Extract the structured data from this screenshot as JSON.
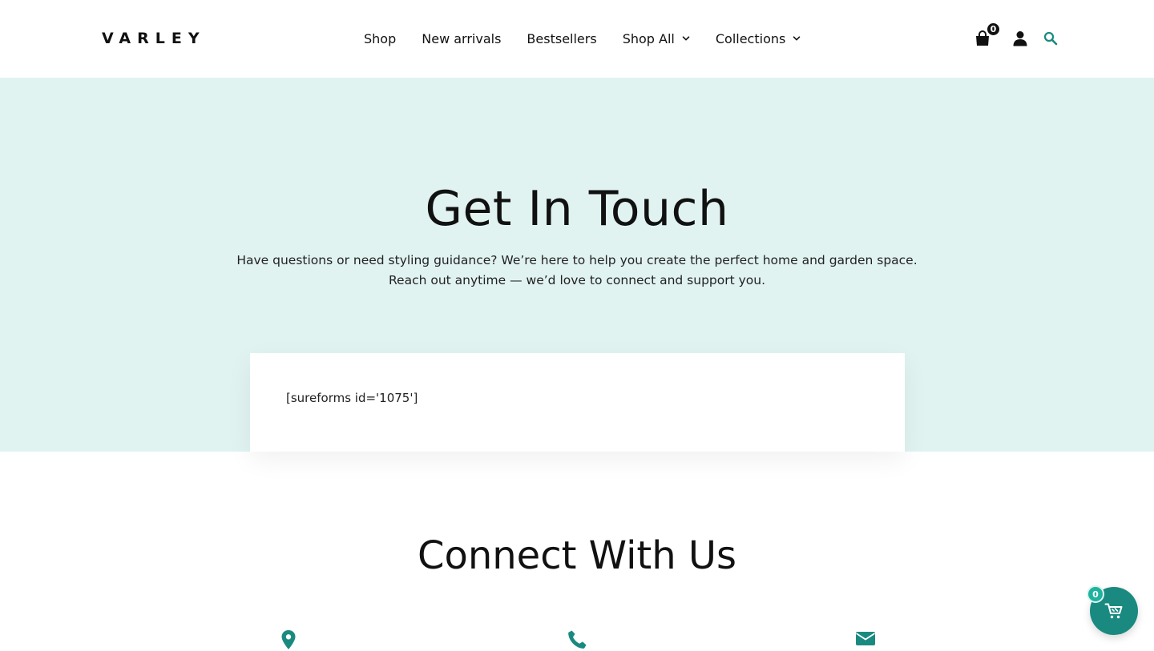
{
  "header": {
    "logo": "VARLEY",
    "nav": [
      {
        "label": "Shop",
        "has_dropdown": false
      },
      {
        "label": "New arrivals",
        "has_dropdown": false
      },
      {
        "label": "Bestsellers",
        "has_dropdown": false
      },
      {
        "label": "Shop All",
        "has_dropdown": true
      },
      {
        "label": "Collections",
        "has_dropdown": true
      }
    ],
    "cart_count": "0",
    "icons": [
      "shopping-bag-icon",
      "user-icon",
      "search-icon"
    ]
  },
  "hero": {
    "title": "Get In Touch",
    "text_line1": "Have questions or need styling guidance? We’re here to help you create the perfect home and garden space.",
    "text_line2": "Reach out anytime — we’d love to connect and support you.",
    "background": "#e0f3f1"
  },
  "form": {
    "shortcode": "[sureforms id='1075']"
  },
  "connect": {
    "title": "Connect With Us",
    "icons": [
      "map-pin-icon",
      "phone-icon",
      "envelope-icon"
    ]
  },
  "floating_cart": {
    "count": "0",
    "color": "#1a8a80"
  },
  "colors": {
    "accent": "#1a8a80",
    "search_icon": "#1a8a80",
    "text": "#111111"
  }
}
